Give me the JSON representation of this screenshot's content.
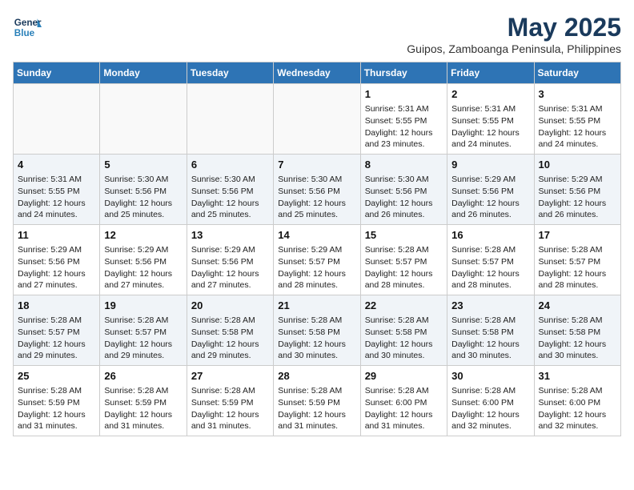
{
  "header": {
    "logo_line1": "General",
    "logo_line2": "Blue",
    "month": "May 2025",
    "location": "Guipos, Zamboanga Peninsula, Philippines"
  },
  "days_of_week": [
    "Sunday",
    "Monday",
    "Tuesday",
    "Wednesday",
    "Thursday",
    "Friday",
    "Saturday"
  ],
  "weeks": [
    [
      {
        "day": "",
        "info": ""
      },
      {
        "day": "",
        "info": ""
      },
      {
        "day": "",
        "info": ""
      },
      {
        "day": "",
        "info": ""
      },
      {
        "day": "1",
        "info": "Sunrise: 5:31 AM\nSunset: 5:55 PM\nDaylight: 12 hours\nand 23 minutes."
      },
      {
        "day": "2",
        "info": "Sunrise: 5:31 AM\nSunset: 5:55 PM\nDaylight: 12 hours\nand 24 minutes."
      },
      {
        "day": "3",
        "info": "Sunrise: 5:31 AM\nSunset: 5:55 PM\nDaylight: 12 hours\nand 24 minutes."
      }
    ],
    [
      {
        "day": "4",
        "info": "Sunrise: 5:31 AM\nSunset: 5:55 PM\nDaylight: 12 hours\nand 24 minutes."
      },
      {
        "day": "5",
        "info": "Sunrise: 5:30 AM\nSunset: 5:56 PM\nDaylight: 12 hours\nand 25 minutes."
      },
      {
        "day": "6",
        "info": "Sunrise: 5:30 AM\nSunset: 5:56 PM\nDaylight: 12 hours\nand 25 minutes."
      },
      {
        "day": "7",
        "info": "Sunrise: 5:30 AM\nSunset: 5:56 PM\nDaylight: 12 hours\nand 25 minutes."
      },
      {
        "day": "8",
        "info": "Sunrise: 5:30 AM\nSunset: 5:56 PM\nDaylight: 12 hours\nand 26 minutes."
      },
      {
        "day": "9",
        "info": "Sunrise: 5:29 AM\nSunset: 5:56 PM\nDaylight: 12 hours\nand 26 minutes."
      },
      {
        "day": "10",
        "info": "Sunrise: 5:29 AM\nSunset: 5:56 PM\nDaylight: 12 hours\nand 26 minutes."
      }
    ],
    [
      {
        "day": "11",
        "info": "Sunrise: 5:29 AM\nSunset: 5:56 PM\nDaylight: 12 hours\nand 27 minutes."
      },
      {
        "day": "12",
        "info": "Sunrise: 5:29 AM\nSunset: 5:56 PM\nDaylight: 12 hours\nand 27 minutes."
      },
      {
        "day": "13",
        "info": "Sunrise: 5:29 AM\nSunset: 5:56 PM\nDaylight: 12 hours\nand 27 minutes."
      },
      {
        "day": "14",
        "info": "Sunrise: 5:29 AM\nSunset: 5:57 PM\nDaylight: 12 hours\nand 28 minutes."
      },
      {
        "day": "15",
        "info": "Sunrise: 5:28 AM\nSunset: 5:57 PM\nDaylight: 12 hours\nand 28 minutes."
      },
      {
        "day": "16",
        "info": "Sunrise: 5:28 AM\nSunset: 5:57 PM\nDaylight: 12 hours\nand 28 minutes."
      },
      {
        "day": "17",
        "info": "Sunrise: 5:28 AM\nSunset: 5:57 PM\nDaylight: 12 hours\nand 28 minutes."
      }
    ],
    [
      {
        "day": "18",
        "info": "Sunrise: 5:28 AM\nSunset: 5:57 PM\nDaylight: 12 hours\nand 29 minutes."
      },
      {
        "day": "19",
        "info": "Sunrise: 5:28 AM\nSunset: 5:57 PM\nDaylight: 12 hours\nand 29 minutes."
      },
      {
        "day": "20",
        "info": "Sunrise: 5:28 AM\nSunset: 5:58 PM\nDaylight: 12 hours\nand 29 minutes."
      },
      {
        "day": "21",
        "info": "Sunrise: 5:28 AM\nSunset: 5:58 PM\nDaylight: 12 hours\nand 30 minutes."
      },
      {
        "day": "22",
        "info": "Sunrise: 5:28 AM\nSunset: 5:58 PM\nDaylight: 12 hours\nand 30 minutes."
      },
      {
        "day": "23",
        "info": "Sunrise: 5:28 AM\nSunset: 5:58 PM\nDaylight: 12 hours\nand 30 minutes."
      },
      {
        "day": "24",
        "info": "Sunrise: 5:28 AM\nSunset: 5:58 PM\nDaylight: 12 hours\nand 30 minutes."
      }
    ],
    [
      {
        "day": "25",
        "info": "Sunrise: 5:28 AM\nSunset: 5:59 PM\nDaylight: 12 hours\nand 31 minutes."
      },
      {
        "day": "26",
        "info": "Sunrise: 5:28 AM\nSunset: 5:59 PM\nDaylight: 12 hours\nand 31 minutes."
      },
      {
        "day": "27",
        "info": "Sunrise: 5:28 AM\nSunset: 5:59 PM\nDaylight: 12 hours\nand 31 minutes."
      },
      {
        "day": "28",
        "info": "Sunrise: 5:28 AM\nSunset: 5:59 PM\nDaylight: 12 hours\nand 31 minutes."
      },
      {
        "day": "29",
        "info": "Sunrise: 5:28 AM\nSunset: 6:00 PM\nDaylight: 12 hours\nand 31 minutes."
      },
      {
        "day": "30",
        "info": "Sunrise: 5:28 AM\nSunset: 6:00 PM\nDaylight: 12 hours\nand 32 minutes."
      },
      {
        "day": "31",
        "info": "Sunrise: 5:28 AM\nSunset: 6:00 PM\nDaylight: 12 hours\nand 32 minutes."
      }
    ]
  ]
}
